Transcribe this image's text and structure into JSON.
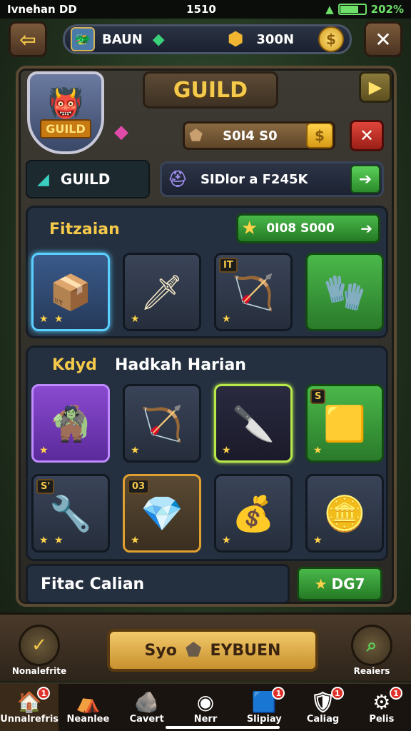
{
  "status": {
    "carrier": "Ivnehan DD",
    "time": "1510",
    "battery": "202%",
    "battery_level": 0.7
  },
  "topbar": {
    "back": "⇦",
    "player_label": "BAUN",
    "gold_amount": "300N",
    "coin_symbol": "$",
    "close": "✕"
  },
  "header": {
    "title": "GUILD",
    "emblem_text": "GUILD",
    "next": "▶"
  },
  "funds": {
    "value": "S0I4 S0",
    "coin_symbol": "$",
    "dismiss": "✕"
  },
  "tabs": {
    "guild_label": "GUILD",
    "search_value": "SIDlor a F245K",
    "go": "➔"
  },
  "section1": {
    "title": "Fitzaian",
    "reward_value": "0I08 S000",
    "reward_arrow": "➔",
    "slots": [
      {
        "icon": "📦",
        "stars": "★ ★",
        "badge": ""
      },
      {
        "icon": "🗡",
        "stars": "★",
        "badge": ""
      },
      {
        "icon": "🏹",
        "stars": "★",
        "badge": "IT"
      },
      {
        "icon": "🧤",
        "stars": "",
        "badge": ""
      }
    ]
  },
  "section2": {
    "title_a": "Kdyd",
    "title_b": "Hadkah Harian",
    "slots": [
      {
        "icon": "🧌",
        "stars": "★",
        "badge": ""
      },
      {
        "icon": "🏹",
        "stars": "★",
        "badge": ""
      },
      {
        "icon": "🔪",
        "stars": "★",
        "badge": ""
      },
      {
        "icon": "🟨",
        "stars": "★",
        "badge": "S"
      },
      {
        "icon": "🔧",
        "stars": "★ ★",
        "badge": "S'"
      },
      {
        "icon": "💎",
        "stars": "★",
        "badge": "03"
      },
      {
        "icon": "💰",
        "stars": "★",
        "badge": ""
      },
      {
        "icon": "🪙",
        "stars": "★",
        "badge": ""
      }
    ]
  },
  "section3": {
    "title": "Fitac Calian",
    "claim_label": "DG7"
  },
  "bottom": {
    "left_label": "Nonalefrite",
    "cta_label_a": "Syo",
    "cta_label_b": "EYBUEN",
    "right_label": "Reaiers"
  },
  "nav": [
    {
      "label": "Unnalrefris",
      "icon": "🏠",
      "badge": "1"
    },
    {
      "label": "Neanlee",
      "icon": "⛺",
      "badge": ""
    },
    {
      "label": "Cavert",
      "icon": "🪨",
      "badge": ""
    },
    {
      "label": "Nerr",
      "icon": "◉",
      "badge": ""
    },
    {
      "label": "Slipiay",
      "icon": "🟦",
      "badge": "1"
    },
    {
      "label": "Caliag",
      "icon": "🛡",
      "badge": "1"
    },
    {
      "label": "Pelis",
      "icon": "⚙",
      "badge": "1"
    }
  ]
}
